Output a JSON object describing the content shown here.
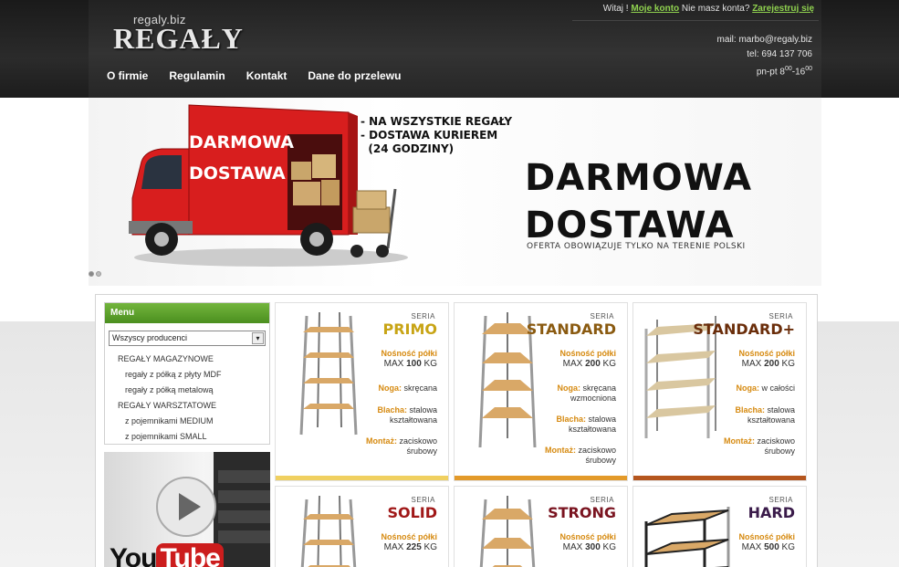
{
  "logo": {
    "sub": "regaly.biz",
    "main": "REGAŁY"
  },
  "login": {
    "greeting": "Witaj !",
    "my_account": "Moje konto",
    "no_account": "Nie masz konta?",
    "register": "Zarejestruj się"
  },
  "contact": {
    "mail": "mail: marbo@regaly.biz",
    "tel": "tel: 694 137 706",
    "hours_prefix": "pn-pt 8",
    "hours_sup1": "00",
    "hours_mid": "-16",
    "hours_sup2": "00"
  },
  "nav": [
    "O firmie",
    "Regulamin",
    "Kontakt",
    "Dane do przelewu"
  ],
  "banner": {
    "truck_line1": "DARMOWA",
    "truck_line2": "DOSTAWA",
    "list": [
      "- NA WSZYSTKIE REGAŁY",
      "- DOSTAWA KURIEREM",
      "  (24 GODZINY)"
    ],
    "title_line1": "DARMOWA",
    "title_line2": "DOSTAWA",
    "note": "OFERTA OBOWIĄZUJE TYLKO NA TERENIE POLSKI"
  },
  "sidebar": {
    "menu_title": "Menu",
    "select_value": "Wszyscy producenci",
    "items": [
      {
        "label": "REGAŁY MAGAZYNOWE",
        "level": "top"
      },
      {
        "label": "regały z półką z płyty MDF",
        "level": "sub"
      },
      {
        "label": "regały z półką metalową",
        "level": "sub"
      },
      {
        "label": "REGAŁY WARSZTATOWE",
        "level": "top"
      },
      {
        "label": "z pojemnikami MEDIUM",
        "level": "sub"
      },
      {
        "label": "z pojemnikami SMALL",
        "level": "sub"
      }
    ],
    "youtube_you": "You",
    "youtube_tube": "Tube"
  },
  "products": [
    {
      "seria": "SERIA",
      "name": "PRIMO",
      "color": "#c8a415",
      "capacity_label": "Nośność półki",
      "capacity_prefix": "MAX",
      "capacity_value": "100",
      "capacity_unit": "KG",
      "leg_label": "Noga:",
      "leg_value": "skręcana",
      "sheet_label": "Blacha:",
      "sheet_value_1": "stalowa",
      "sheet_value_2": "kształtowana",
      "mount_label": "Montaż:",
      "mount_value_1": "zaciskowo",
      "mount_value_2": "śrubowy",
      "bar": "#f0d060"
    },
    {
      "seria": "SERIA",
      "name": "STANDARD",
      "color": "#8a5a10",
      "capacity_label": "Nośność półki",
      "capacity_prefix": "MAX",
      "capacity_value": "200",
      "capacity_unit": "KG",
      "leg_label": "Noga:",
      "leg_value": "skręcana",
      "leg_value_2": "wzmocniona",
      "sheet_label": "Blacha:",
      "sheet_value_1": "stalowa",
      "sheet_value_2": "kształtowana",
      "mount_label": "Montaż:",
      "mount_value_1": "zaciskowo",
      "mount_value_2": "śrubowy",
      "bar": "#e39a2a"
    },
    {
      "seria": "SERIA",
      "name": "STANDARD+",
      "color": "#6a2d0a",
      "capacity_label": "Nośność półki",
      "capacity_prefix": "MAX",
      "capacity_value": "200",
      "capacity_unit": "KG",
      "leg_label": "Noga:",
      "leg_value": "w całości",
      "sheet_label": "Blacha:",
      "sheet_value_1": "stalowa",
      "sheet_value_2": "kształtowana",
      "mount_label": "Montaż:",
      "mount_value_1": "zaciskowo",
      "mount_value_2": "śrubowy",
      "bar": "#b5561e"
    },
    {
      "seria": "SERIA",
      "name": "SOLID",
      "color": "#a01818",
      "capacity_label": "Nośność półki",
      "capacity_prefix": "MAX",
      "capacity_value": "225",
      "capacity_unit": "KG"
    },
    {
      "seria": "SERIA",
      "name": "STRONG",
      "color": "#7a1420",
      "capacity_label": "Nośność półki",
      "capacity_prefix": "MAX",
      "capacity_value": "300",
      "capacity_unit": "KG"
    },
    {
      "seria": "SERIA",
      "name": "HARD",
      "color": "#3a1b4a",
      "capacity_label": "Nośność półki",
      "capacity_prefix": "MAX",
      "capacity_value": "500",
      "capacity_unit": "KG"
    }
  ]
}
